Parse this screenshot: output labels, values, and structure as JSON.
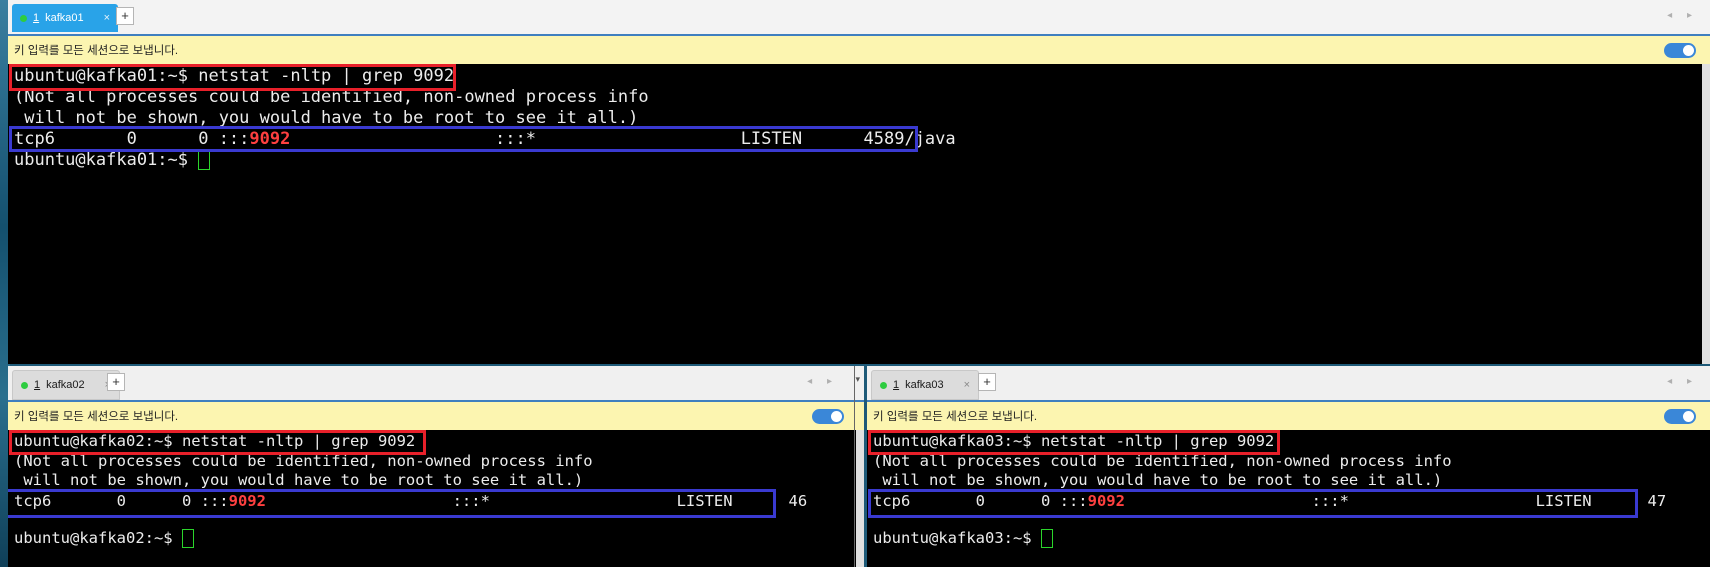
{
  "info_message": "키 입력를 모든 세션으로 보냅니다.",
  "new_tab_symbol": "+",
  "close_symbol": "×",
  "nav_arrows": "◂ ▸",
  "dropdown_symbol": "▾",
  "sessions": {
    "top": {
      "tab_number": "1",
      "tab_name": "kafka01",
      "prompt": "ubuntu@kafka01:~$",
      "command": " netstat -nltp | grep 9092",
      "warning1": "(Not all processes could be identified, non-owned process info",
      "warning2": " will not be shown, you would have to be root to see it all.)",
      "row_prefix": "tcp6       0      0 :::",
      "row_port": "9092",
      "row_suffix": "                    :::*                    LISTEN      4589/java",
      "prompt2": "ubuntu@kafka01:~$ "
    },
    "bottom_left": {
      "tab_number": "1",
      "tab_name": "kafka02",
      "prompt": "ubuntu@kafka02:~$",
      "command": " netstat -nltp | grep 9092",
      "warning1": "(Not all processes could be identified, non-owned process info",
      "warning2": " will not be shown, you would have to be root to see it all.)",
      "row_prefix": "tcp6       0      0 :::",
      "row_port": "9092",
      "row_suffix": "                    :::*                    LISTEN      46",
      "prompt2": "ubuntu@kafka02:~$ "
    },
    "bottom_right": {
      "tab_number": "1",
      "tab_name": "kafka03",
      "prompt": "ubuntu@kafka03:~$",
      "command": " netstat -nltp | grep 9092",
      "warning1": "(Not all processes could be identified, non-owned process info",
      "warning2": " will not be shown, you would have to be root to see it all.)",
      "row_prefix": "tcp6       0      0 :::",
      "row_port": "9092",
      "row_suffix": "                    :::*                    LISTEN      47",
      "prompt2": "ubuntu@kafka03:~$ "
    }
  },
  "colors": {
    "port_highlight": "#ff4040",
    "command_box": "#e8202a",
    "result_box": "#3a3ad0",
    "cursor": "#2bd52b",
    "info_bar": "#fcf5b0",
    "active_tab": "#29a3e8"
  }
}
